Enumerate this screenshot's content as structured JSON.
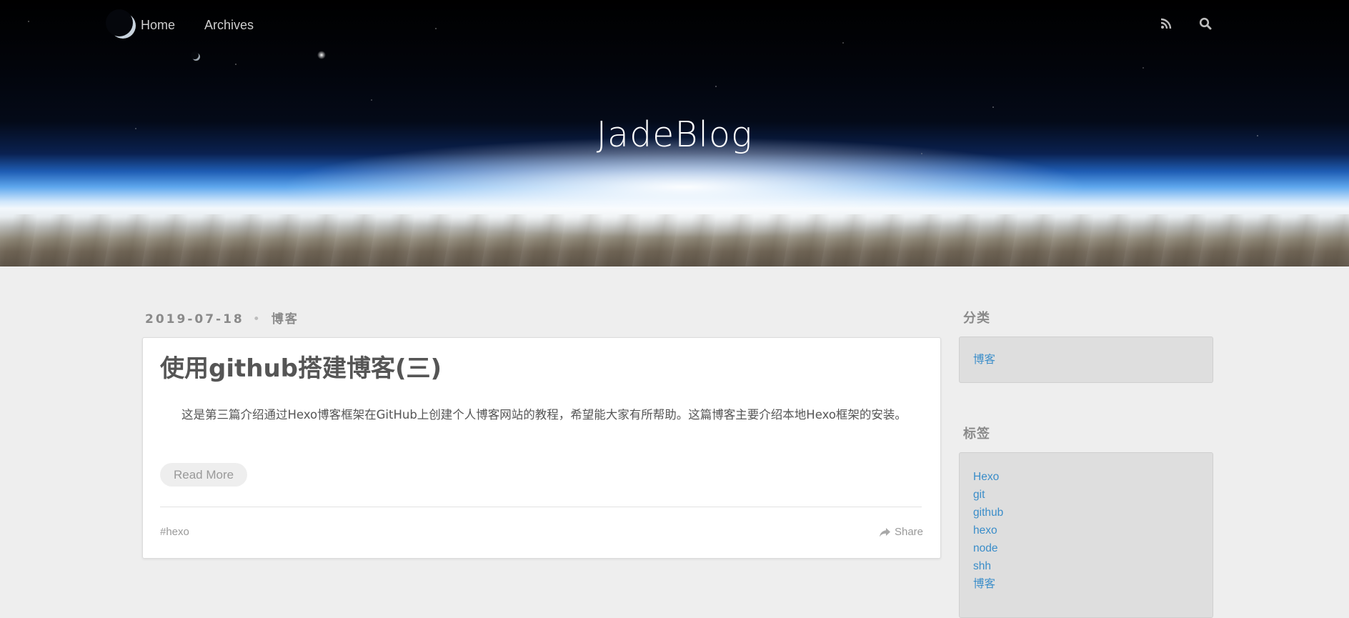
{
  "nav": {
    "items": [
      {
        "label": "Home"
      },
      {
        "label": "Archives"
      }
    ]
  },
  "header": {
    "site_title": "JadeBlog",
    "icons": [
      "rss-icon",
      "search-icon"
    ]
  },
  "post": {
    "date": "2019-07-18",
    "separator": "•",
    "category": "博客",
    "title": "使用github搭建博客(三)",
    "excerpt": "这是第三篇介绍通过Hexo博客框架在GitHub上创建个人博客网站的教程，希望能大家有所帮助。这篇博客主要介绍本地Hexo框架的安装。",
    "read_more_label": "Read More",
    "tag": "#hexo",
    "share_label": "Share"
  },
  "sidebar": {
    "categories": {
      "title": "分类",
      "items": [
        "博客"
      ]
    },
    "tags": {
      "title": "标签",
      "items": [
        "Hexo",
        "git",
        "github",
        "hexo",
        "node",
        "shh",
        "博客"
      ]
    }
  },
  "colors": {
    "page_bg": "#eeeeee",
    "link": "#3a8dc9",
    "meta_text": "#8a8a8a",
    "body_text": "#555555"
  }
}
